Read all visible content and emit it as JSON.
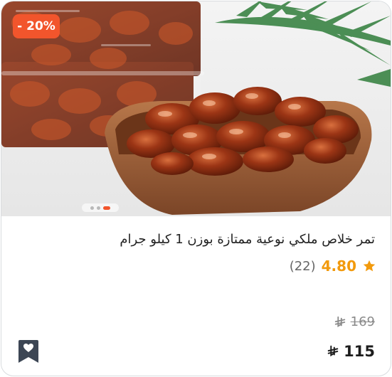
{
  "product": {
    "discount_label": "- 20%",
    "title": "تمر خلاص ملكي نوعية ممتازة بوزن 1 كيلو جرام",
    "rating_value": "4.80",
    "rating_count": "(22)",
    "old_price": "169",
    "price": "115",
    "image_name": "dates-product-image",
    "carousel": {
      "total_dots": 3,
      "active_index": 2
    }
  },
  "colors": {
    "accent": "#f2552c",
    "star": "#f29a0d",
    "text": "#222222",
    "muted": "#8a8a8a"
  },
  "icons": {
    "rating": "star-icon",
    "currency": "riyal-icon",
    "wishlist": "bookmark-heart-icon"
  }
}
